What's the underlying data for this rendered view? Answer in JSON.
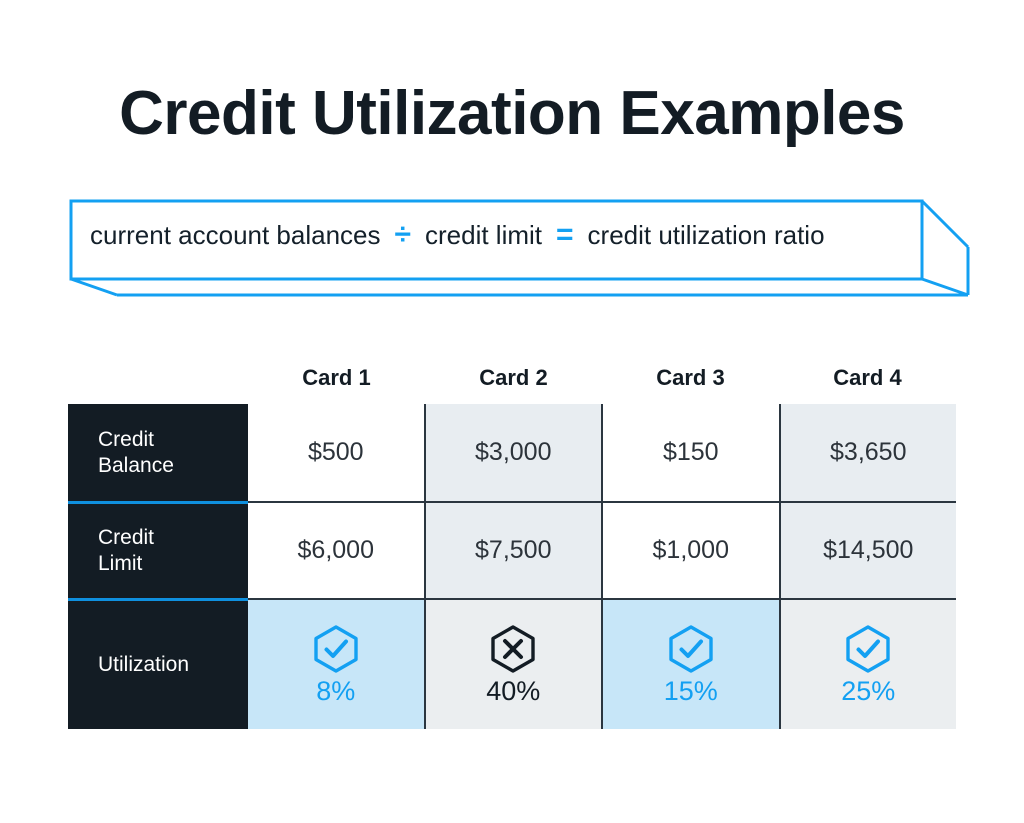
{
  "title": "Credit Utilization Examples",
  "formula": {
    "term1": "current account balances",
    "divide_symbol": "÷",
    "term2": "credit limit",
    "equals_symbol": "=",
    "result": "credit utilization ratio"
  },
  "colors": {
    "accent_blue": "#13a0f2",
    "dark_navy": "#131c24",
    "cell_gray": "#e8edf1",
    "cell_blue": "#c7e6f8",
    "border_dark": "#2b3640"
  },
  "table": {
    "corner_label": "",
    "column_headers": [
      "Card 1",
      "Card 2",
      "Card 3",
      "Card 4"
    ],
    "rows": [
      {
        "label": "Credit\nBalance",
        "label_line1": "Credit",
        "label_line2": "Balance",
        "values": [
          "$500",
          "$3,000",
          "$150",
          "$3,650"
        ]
      },
      {
        "label": "Credit\nLimit",
        "label_line1": "Credit",
        "label_line2": "Limit",
        "values": [
          "$6,000",
          "$7,500",
          "$1,000",
          "$14,500"
        ]
      },
      {
        "label": "Utilization",
        "label_line1": "Utilization",
        "label_line2": "",
        "values": [
          "8%",
          "40%",
          "15%",
          "25%"
        ],
        "status_icons": [
          "hexagon-check-icon",
          "hexagon-x-icon",
          "hexagon-check-icon",
          "hexagon-check-icon"
        ],
        "status": [
          "good",
          "bad",
          "good",
          "good"
        ]
      }
    ]
  },
  "chart_data": {
    "type": "table",
    "title": "Credit Utilization Examples",
    "categories": [
      "Card 1",
      "Card 2",
      "Card 3",
      "Card 4"
    ],
    "series": [
      {
        "name": "Credit Balance",
        "values": [
          500,
          3000,
          150,
          3650
        ]
      },
      {
        "name": "Credit Limit",
        "values": [
          6000,
          7500,
          1000,
          14500
        ]
      },
      {
        "name": "Utilization",
        "values": [
          8,
          40,
          15,
          25
        ]
      }
    ],
    "ylabel": "",
    "xlabel": "",
    "annotations": [
      "8% good",
      "40% bad",
      "15% good",
      "25% good"
    ]
  }
}
